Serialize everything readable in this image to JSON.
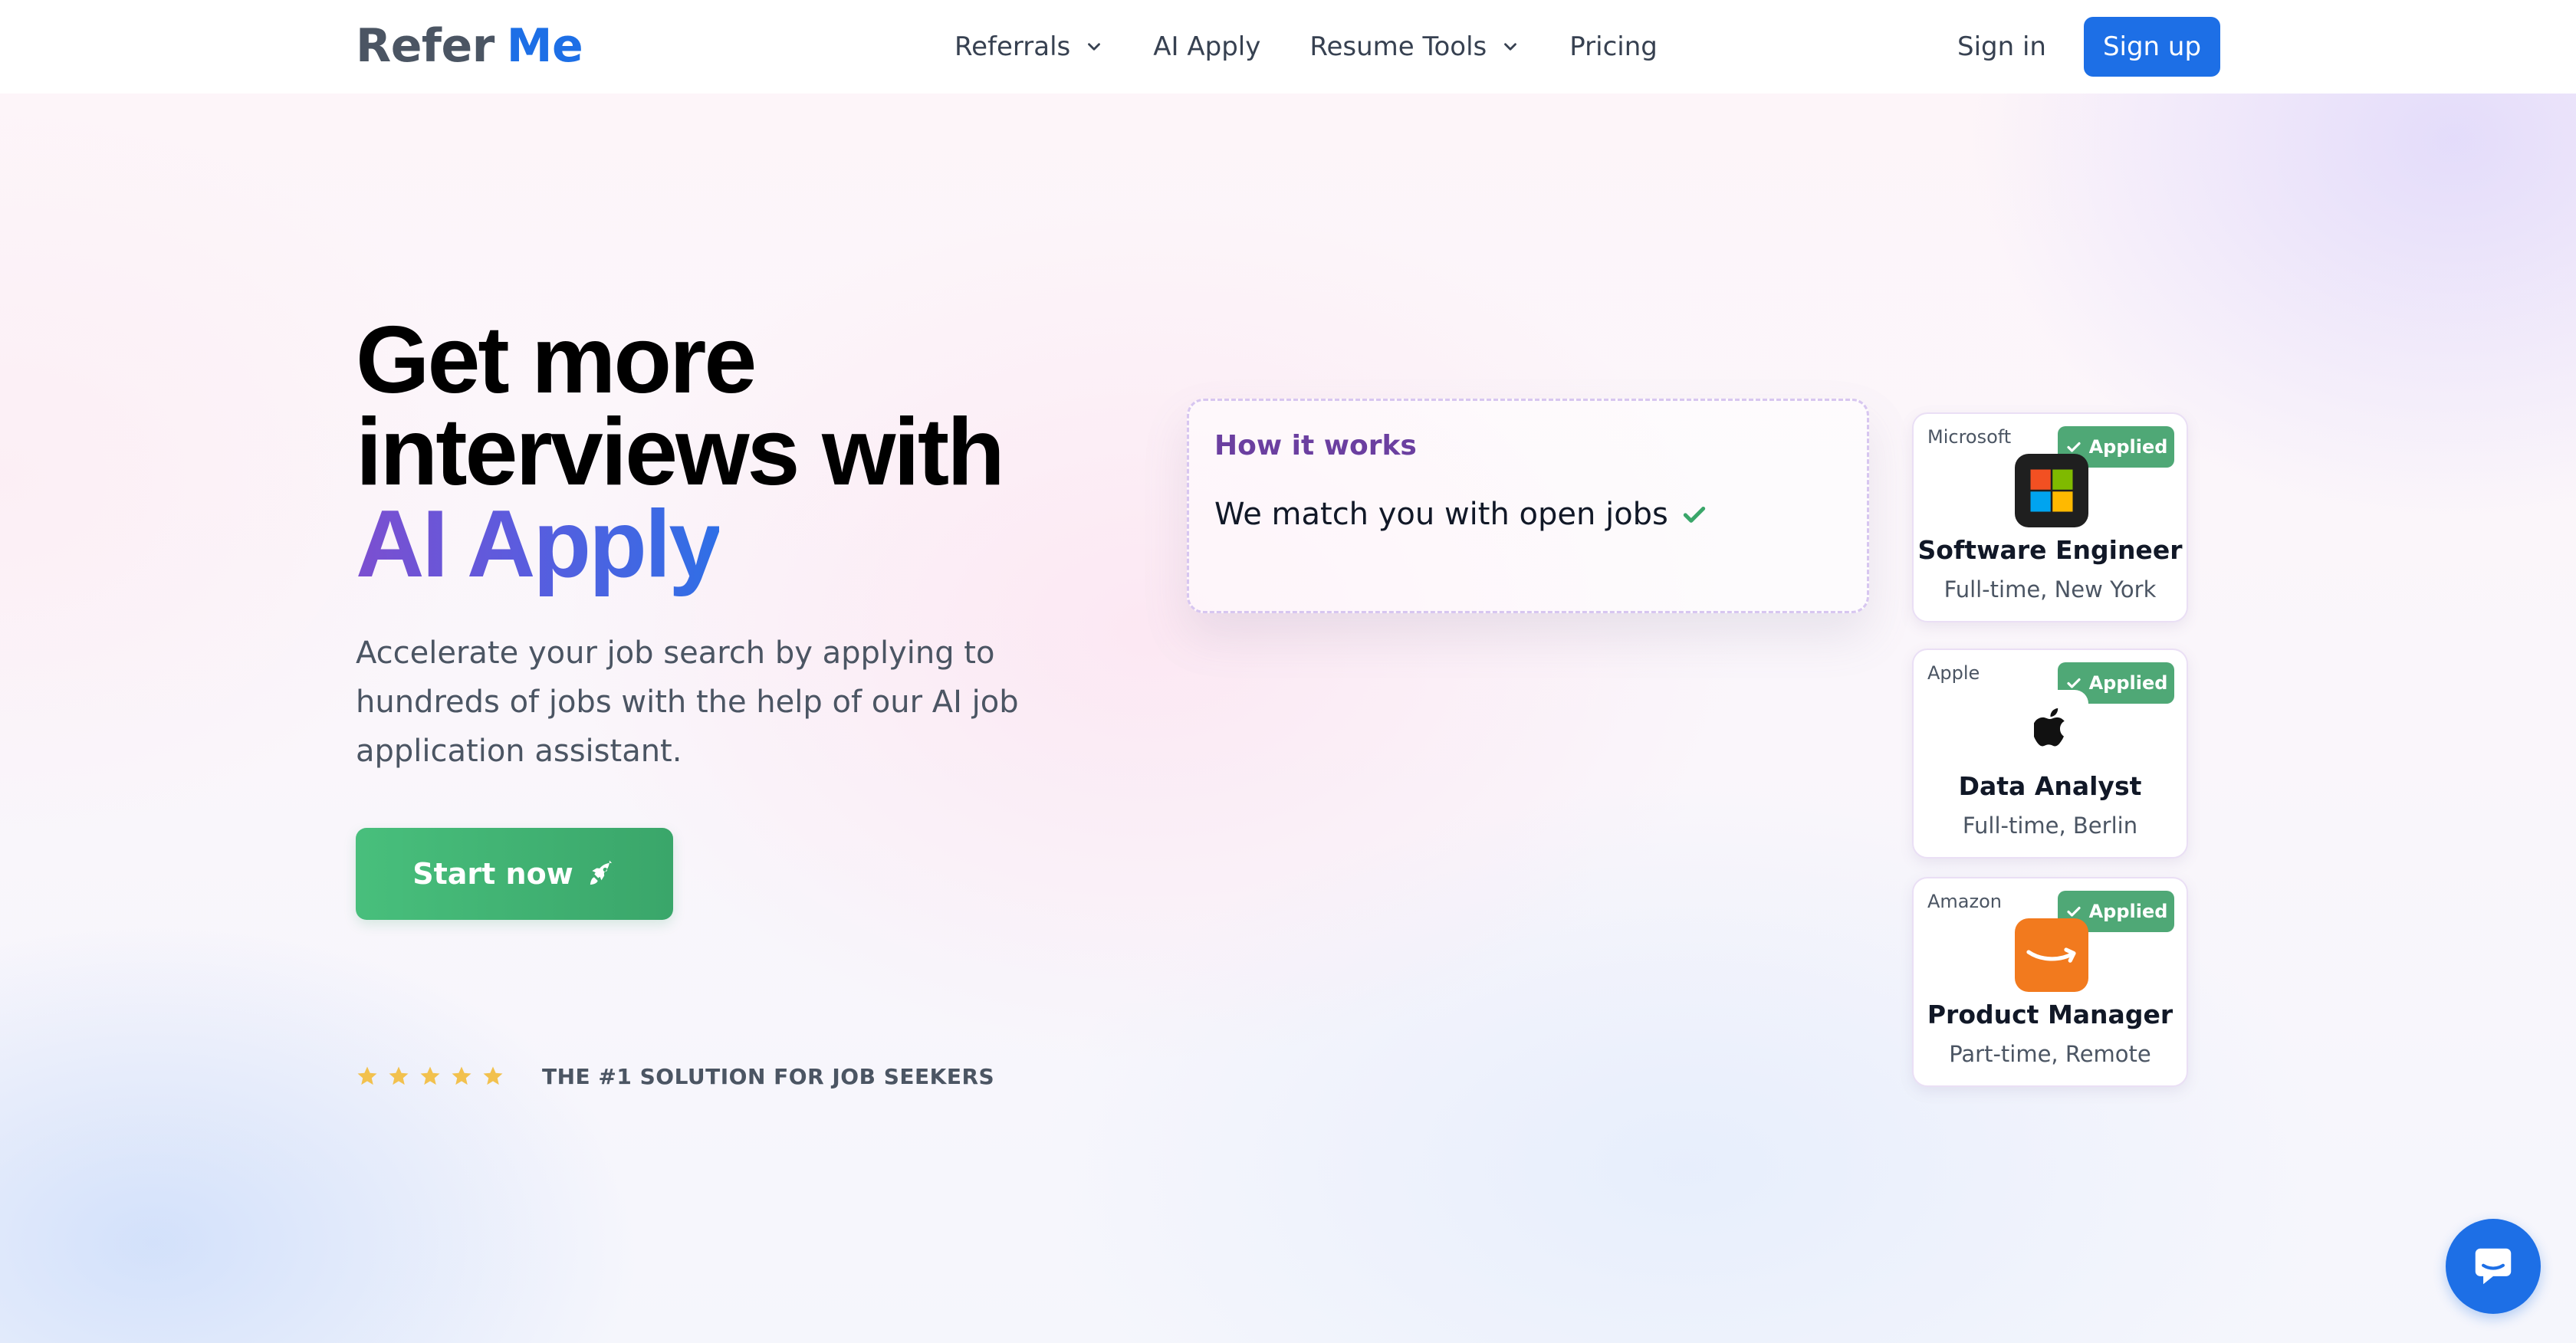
{
  "brand": {
    "logo_part1": "Refer",
    "logo_part2": "Me",
    "accent_color": "#1d6fe6"
  },
  "nav": {
    "items": [
      {
        "label": "Referrals",
        "has_dropdown": true
      },
      {
        "label": "AI Apply",
        "has_dropdown": false
      },
      {
        "label": "Resume Tools",
        "has_dropdown": true
      },
      {
        "label": "Pricing",
        "has_dropdown": false
      }
    ],
    "sign_in": "Sign in",
    "sign_up": "Sign up"
  },
  "hero": {
    "headline_line1": "Get more",
    "headline_line2": "interviews with",
    "headline_highlight": "AI Apply",
    "subtext": "Accelerate your job search by applying to hundreds of jobs with the help of our AI job application assistant.",
    "cta_label": "Start now",
    "cta_icon": "rocket-icon",
    "rating_stars": 5,
    "tagline": "THE #1 SOLUTION FOR JOB SEEKERS"
  },
  "how_it_works": {
    "title": "How it works",
    "step_text": "We match you with open jobs"
  },
  "jobs": [
    {
      "company": "Microsoft",
      "status": "Applied",
      "title": "Software Engineer",
      "meta": "Full-time, New York",
      "logo_icon": "microsoft-logo-icon"
    },
    {
      "company": "Apple",
      "status": "Applied",
      "title": "Data Analyst",
      "meta": "Full-time, Berlin",
      "logo_icon": "apple-logo-icon"
    },
    {
      "company": "Amazon",
      "status": "Applied",
      "title": "Product Manager",
      "meta": "Part-time, Remote",
      "logo_icon": "amazon-logo-icon"
    }
  ],
  "colors": {
    "success": "#4fa876",
    "headline_gradient_start": "#7c4fd0",
    "headline_gradient_end": "#2f6fe6",
    "star": "#f2c14e"
  },
  "chat_widget": {
    "icon": "chat-bubble-icon"
  }
}
